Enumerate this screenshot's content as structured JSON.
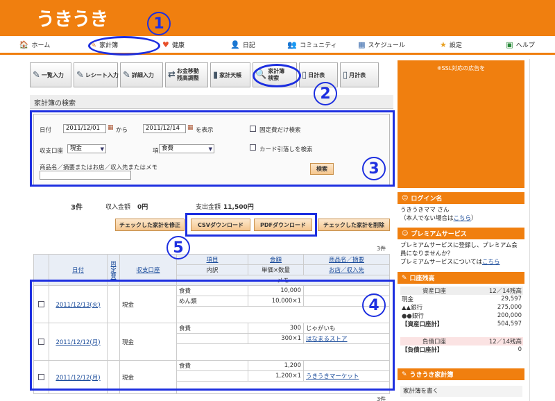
{
  "header": {
    "logo": "うきうき"
  },
  "nav": [
    {
      "label": "ホーム",
      "icon": "🏠"
    },
    {
      "label": "家計簿",
      "icon": "✎"
    },
    {
      "label": "健康",
      "icon": "♥"
    },
    {
      "label": "日記",
      "icon": "👤"
    },
    {
      "label": "コミュニティ",
      "icon": "👥"
    },
    {
      "label": "スケジュール",
      "icon": "▦"
    },
    {
      "label": "設定",
      "icon": "★"
    },
    {
      "label": "ヘルプ",
      "icon": "▣"
    }
  ],
  "annotations": {
    "n1": "1",
    "n2": "2",
    "n3": "3",
    "n4": "4",
    "n5": "5"
  },
  "toolbar": [
    {
      "label": "一覧入力",
      "icon": "✎"
    },
    {
      "label": "レシート入力",
      "icon": "✎"
    },
    {
      "label": "詳細入力",
      "icon": "✎"
    },
    {
      "label": "お金移動\n残高調整",
      "icon": "⇄"
    },
    {
      "label": "家計天帳",
      "icon": "▮"
    },
    {
      "label": "家計簿\n検索",
      "icon": "🔍"
    },
    {
      "label": "日計表",
      "icon": "▯"
    },
    {
      "label": "月計表",
      "icon": "▯"
    }
  ],
  "search": {
    "title": "家計簿の検索",
    "date_label": "日付",
    "date_from": "2011/12/01",
    "from_suffix": "から",
    "date_to": "2011/12/14",
    "to_suffix": "を表示",
    "fixed_only": "固定費だけ検索",
    "account_label": "収支口座",
    "account_value": "現金",
    "item_label": "項目",
    "item_value": "食費",
    "card_only": "カード引落しを検索",
    "keyword_label": "商品名／摘要またはお店／収入先またはメモ",
    "keyword_value": "",
    "search_button": "検索"
  },
  "summary": {
    "count": "3件",
    "income_label": "収入金額",
    "income_value": "0円",
    "expense_label": "支出金額",
    "expense_value": "11,500円"
  },
  "actions": {
    "fix_checked": "チェックした家計を修正",
    "csv": "CSVダウンロード",
    "pdf": "PDFダウンロード",
    "delete_checked": "チェックした家計を削除"
  },
  "table": {
    "count_top": "3件",
    "count_bottom": "3件",
    "h_date": "日付",
    "h_fixed": "固定費",
    "h_account": "収支口座",
    "h_item": "項目",
    "h_amount": "金額",
    "h_product": "商品名／摘要",
    "h_detail": "内訳",
    "h_unit": "単価×数量",
    "h_shop": "お店／収入先",
    "h_memo": "メモ",
    "rows": [
      {
        "date": "2011/12/13(火)",
        "account": "現金",
        "item": "食費",
        "amount": "10,000",
        "product": "",
        "detail": "めん類",
        "unit": "10,000×1",
        "shop": ""
      },
      {
        "date": "2011/12/12(月)",
        "account": "現金",
        "item": "食費",
        "amount": "300",
        "product": "じゃがいも",
        "detail": "",
        "unit": "300×1",
        "shop": "はなまるストア"
      },
      {
        "date": "2011/12/12(月)",
        "account": "現金",
        "item": "食費",
        "amount": "1,200",
        "product": "",
        "detail": "",
        "unit": "1,200×1",
        "shop": "うきうきマーケット"
      }
    ]
  },
  "sidebar": {
    "ad": "※SSL対応の広告を",
    "login_title": "ログイン名",
    "login_name": "うきうきママ さん",
    "login_note_pre": "（本人でない場合は",
    "login_note_link": "こちら",
    "login_note_post": "）",
    "premium_title": "プレミアムサービス",
    "premium_text": "プレミアムサービスに登録し、プレミアム会員になりませんか？",
    "premium_more_pre": "プレミアムサービスについては",
    "premium_more_link": "こちら",
    "balance_title": "口座残高",
    "assets_header": "資産口座",
    "assets_date": "12／14残高",
    "assets": [
      {
        "name": "現金",
        "value": "29,597"
      },
      {
        "name": "▲▲銀行",
        "value": "275,000"
      },
      {
        "name": "●●銀行",
        "value": "200,000"
      }
    ],
    "assets_total_label": "【資産口座計】",
    "assets_total": "504,597",
    "liab_header": "負債口座",
    "liab_date": "12／14残高",
    "liab_total_label": "【負債口座計】",
    "liab_total": "0",
    "ukiuki_title": "うきうき家計簿",
    "ukiuki_item": "家計簿を書く"
  }
}
